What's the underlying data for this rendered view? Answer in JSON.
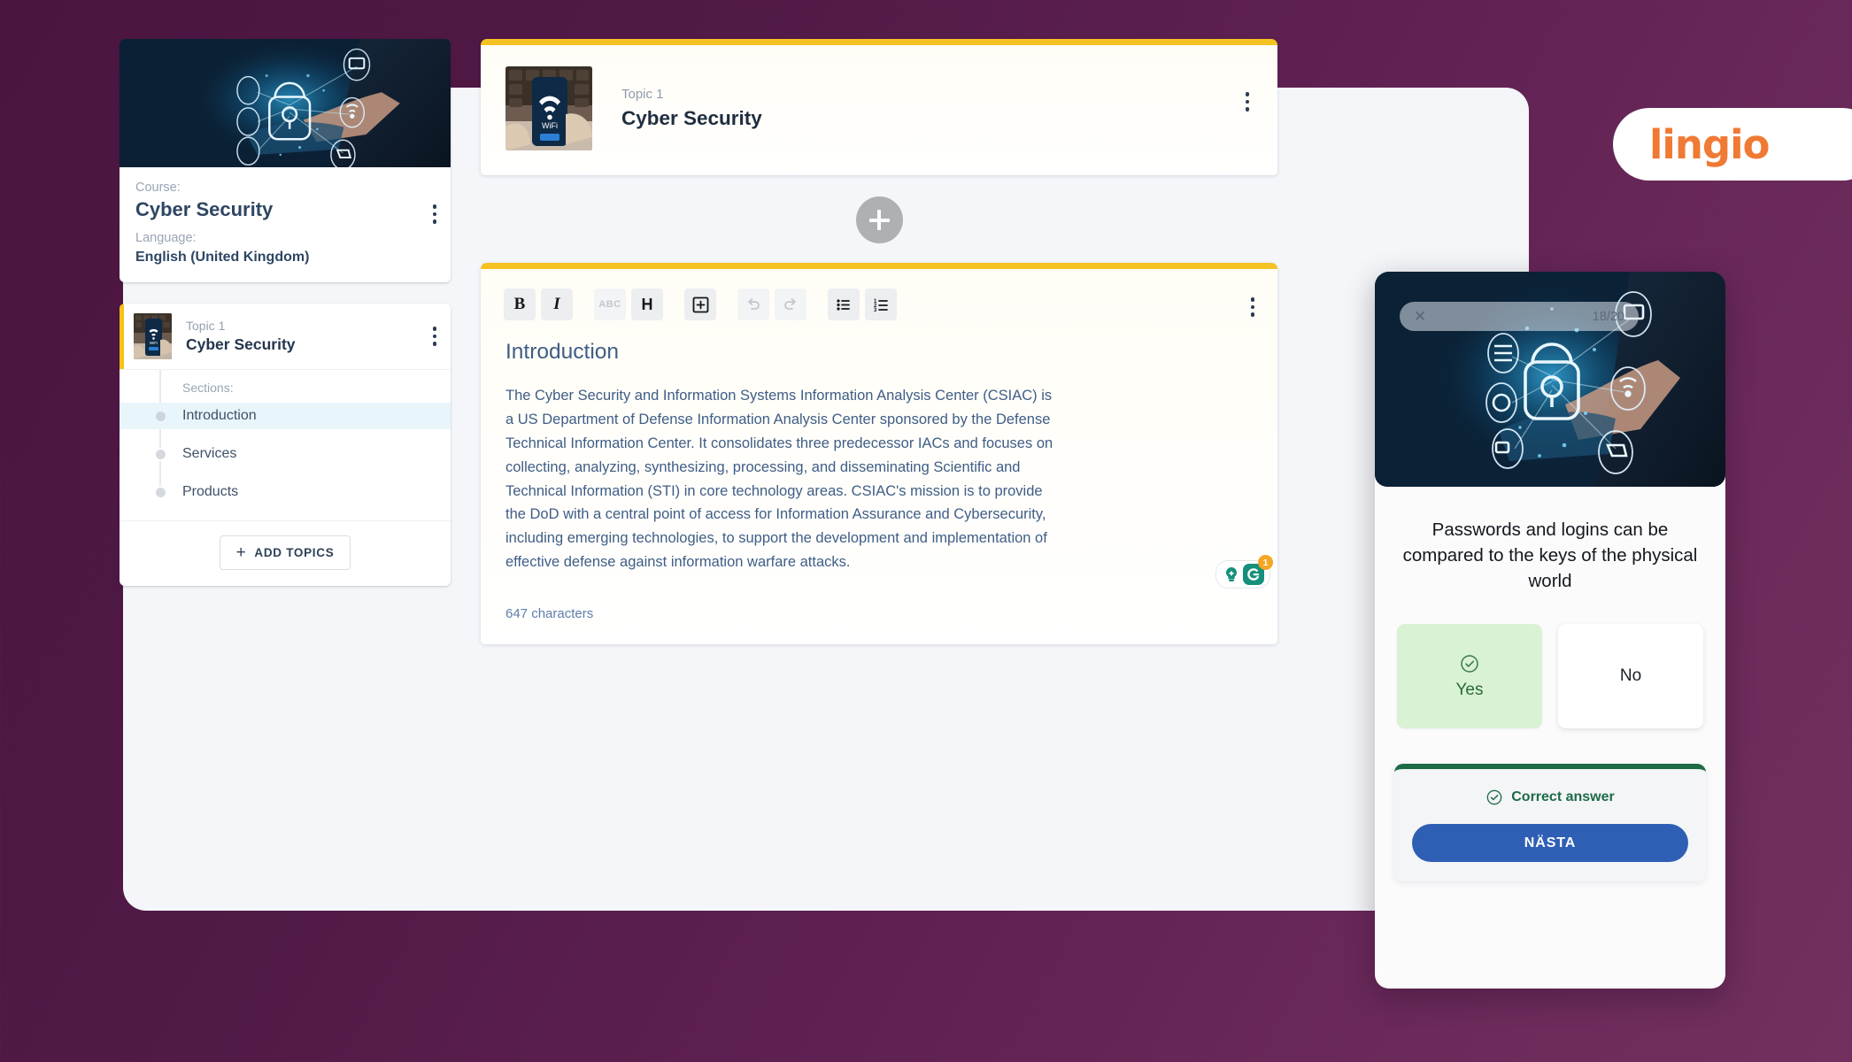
{
  "brand": {
    "logo_text": "lingio",
    "accent_orange": "#f07a33",
    "background_purple": "#4a1540"
  },
  "sidebar": {
    "course_card": {
      "course_label": "Course:",
      "course_name": "Cyber Security",
      "language_label": "Language:",
      "language_value": "English (United Kingdom)",
      "thumbnail_alt": "cyber-security-padlock-image",
      "menu_icon": "kebab-menu-icon"
    },
    "topic": {
      "topic_label": "Topic 1",
      "topic_name": "Cyber Security",
      "accent_color": "#f5c116",
      "thumbnail_alt": "phone-wifi-image",
      "menu_icon": "kebab-menu-icon",
      "sections_label": "Sections:",
      "sections": [
        {
          "label": "Introduction",
          "active": true
        },
        {
          "label": "Services",
          "active": false
        },
        {
          "label": "Products",
          "active": false
        }
      ]
    },
    "add_topics_label": "ADD TOPICS",
    "add_topics_icon": "plus-icon"
  },
  "main": {
    "topic_banner": {
      "topic_label": "Topic 1",
      "topic_name": "Cyber Security",
      "accent_color": "#f6c222",
      "menu_icon": "kebab-menu-icon"
    },
    "add_section_icon": "plus-icon",
    "editor": {
      "accent_color": "#f6c222",
      "toolbar": [
        {
          "name": "bold-button",
          "glyph": "B",
          "style": "bold",
          "disabled": false
        },
        {
          "name": "italic-button",
          "glyph": "I",
          "style": "italic",
          "disabled": false
        },
        {
          "name": "strikethrough-button",
          "glyph": "ABC",
          "style": "abc",
          "disabled": true
        },
        {
          "name": "heading-button",
          "glyph": "H",
          "style": "heading",
          "disabled": false
        },
        {
          "name": "insert-block-button",
          "glyph": "boxplus-icon",
          "style": "icon",
          "disabled": false
        },
        {
          "name": "undo-button",
          "glyph": "undo-icon",
          "style": "icon",
          "disabled": true
        },
        {
          "name": "redo-button",
          "glyph": "redo-icon",
          "style": "icon",
          "disabled": true
        },
        {
          "name": "bullet-list-button",
          "glyph": "bullet-list-icon",
          "style": "icon",
          "disabled": false
        },
        {
          "name": "numbered-list-button",
          "glyph": "numbered-list-icon",
          "style": "icon",
          "disabled": false
        }
      ],
      "menu_icon": "kebab-menu-icon",
      "doc_heading": "Introduction",
      "doc_paragraph": "The Cyber Security and Information Systems Information Analysis Center (CSIAC) is a US Department of Defense Information Analysis Center sponsored by the Defense Technical Information Center. It consolidates three predecessor IACs and focuses on collecting, analyzing, synthesizing, processing, and disseminating Scientific and Technical Information (STI) in core technology areas. CSIAC's mission is to provide the DoD with a central point of access for Information Assurance and Cybersecurity, including emerging technologies, to support the development and implementation of effective defense against information warfare attacks.",
      "character_count": "647 characters",
      "grammarly": {
        "assistant_icon": "lightbulb-icon",
        "logo_icon": "grammarly-g-icon",
        "suggestion_count": "1"
      }
    }
  },
  "phone_preview": {
    "close_icon": "close-icon",
    "progress": "18/20",
    "hero_alt": "cyber-security-padlock-image",
    "question": "Passwords and logins can be compared to the keys of the physical world",
    "answers": [
      {
        "label": "Yes",
        "selected": true,
        "icon": "check-circle-icon"
      },
      {
        "label": "No",
        "selected": false,
        "icon": ""
      }
    ],
    "feedback": {
      "icon": "check-circle-icon",
      "text": "Correct answer",
      "accent_color": "#1d6b47",
      "next_label": "NÄSTA",
      "next_color": "#2f5fb5"
    }
  }
}
